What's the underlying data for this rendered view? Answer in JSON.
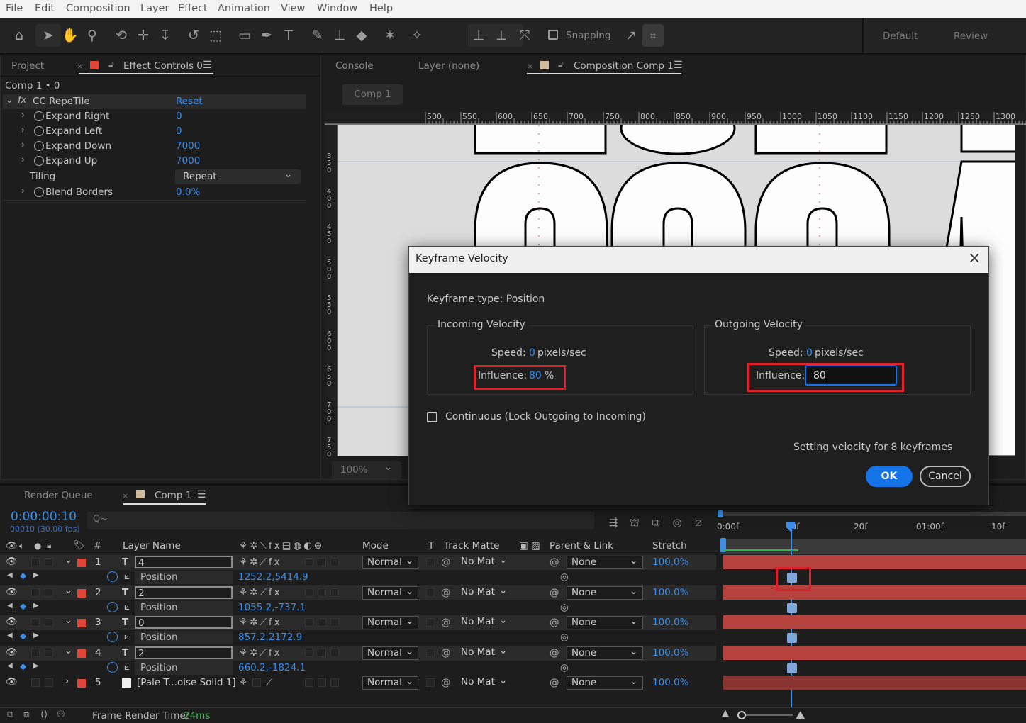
{
  "menu": [
    "File",
    "Edit",
    "Composition",
    "Layer",
    "Effect",
    "Animation",
    "View",
    "Window",
    "Help"
  ],
  "toolbar": {
    "snapping_label": "Snapping",
    "workspaces": [
      "Default",
      "Review"
    ]
  },
  "left_panel": {
    "tabs": {
      "project": "Project",
      "effect_controls": "Effect Controls 0"
    },
    "breadcrumb": "Comp 1 • 0",
    "effect": {
      "fx": "fx",
      "name": "CC RepeTile",
      "reset": "Reset"
    },
    "properties": [
      {
        "label": "Expand Right",
        "value": "0"
      },
      {
        "label": "Expand Left",
        "value": "0"
      },
      {
        "label": "Expand Down",
        "value": "7000"
      },
      {
        "label": "Expand Up",
        "value": "7000"
      }
    ],
    "tiling": {
      "label": "Tiling",
      "value": "Repeat"
    },
    "blend": {
      "label": "Blend Borders",
      "value": "0.0%"
    }
  },
  "viewer_panel": {
    "tabs": {
      "console": "Console",
      "layer": "Layer (none)",
      "composition": "Composition Comp 1"
    },
    "comp_button": "Comp 1",
    "zoom": "100%",
    "ruler_h": [
      "500",
      "550",
      "600",
      "650",
      "700",
      "750",
      "800",
      "850",
      "900",
      "950",
      "1000",
      "1050",
      "1100",
      "1150",
      "1200",
      "1250",
      "1300"
    ],
    "ruler_v": [
      "350",
      "400",
      "450",
      "500",
      "550",
      "600",
      "650",
      "700",
      "750"
    ]
  },
  "dialog": {
    "title": "Keyframe Velocity",
    "keyframe_type": "Keyframe type: Position",
    "incoming": {
      "legend": "Incoming Velocity",
      "speed_label": "Speed:",
      "speed_value": "0",
      "speed_unit": "pixels/sec",
      "influence_label": "Influence:",
      "influence_value": "80",
      "influence_unit": "%"
    },
    "outgoing": {
      "legend": "Outgoing Velocity",
      "speed_label": "Speed:",
      "speed_value": "0",
      "speed_unit": "pixels/sec",
      "influence_label": "Influence:",
      "influence_value": "80"
    },
    "continuous_label": "Continuous (Lock Outgoing to Incoming)",
    "status": "Setting velocity for 8 keyframes",
    "ok": "OK",
    "cancel": "Cancel"
  },
  "timeline": {
    "tabs": {
      "render_queue": "Render Queue",
      "comp": "Comp 1"
    },
    "timecode": "0:00:00:10",
    "fps": "00010 (30.00 fps)",
    "search_placeholder": "Q~",
    "columns": {
      "num": "#",
      "layer_name": "Layer Name",
      "mode": "Mode",
      "t": "T",
      "track_matte": "Track Matte",
      "parent": "Parent & Link",
      "stretch": "Stretch"
    },
    "ruler": [
      "0:00f",
      "10f",
      "20f",
      "01:00f",
      "10f"
    ],
    "layers": [
      {
        "num": "1",
        "type": "T",
        "name": "4",
        "mode": "Normal",
        "matte": "No Mat",
        "parent": "None",
        "stretch": "100.0%",
        "prop": "Position",
        "prop_value": "1252.2,5414.9"
      },
      {
        "num": "2",
        "type": "T",
        "name": "2",
        "mode": "Normal",
        "matte": "No Mat",
        "parent": "None",
        "stretch": "100.0%",
        "prop": "Position",
        "prop_value": "1055.2,-737.1"
      },
      {
        "num": "3",
        "type": "T",
        "name": "0",
        "mode": "Normal",
        "matte": "No Mat",
        "parent": "None",
        "stretch": "100.0%",
        "prop": "Position",
        "prop_value": "857.2,2172.9"
      },
      {
        "num": "4",
        "type": "T",
        "name": "2",
        "mode": "Normal",
        "matte": "No Mat",
        "parent": "None",
        "stretch": "100.0%",
        "prop": "Position",
        "prop_value": "660.2,-1824.1"
      }
    ],
    "layer5": {
      "num": "5",
      "name": "[Pale T...oise Solid 1]",
      "mode": "Normal",
      "matte": "No Mat",
      "parent": "None",
      "stretch": "100.0%"
    },
    "render_time_label": "Frame Render Time:",
    "render_time_value": "24ms"
  },
  "colors": {
    "accent": "#1473e6",
    "link": "#3b8eea",
    "highlight": "#e0202a",
    "track": "#b5423d",
    "label": "#e0453a"
  }
}
